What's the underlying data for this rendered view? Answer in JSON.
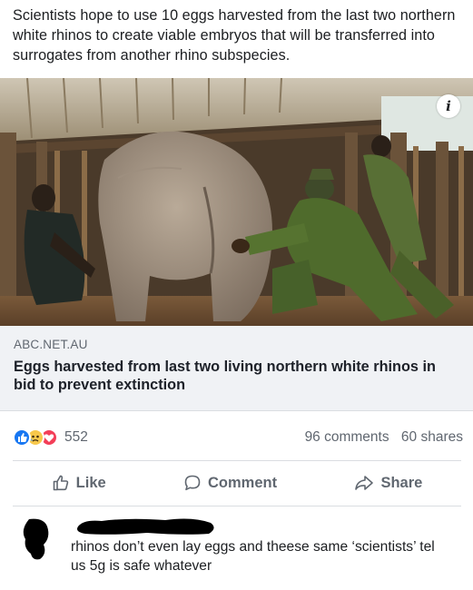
{
  "post": {
    "text": "Scientists hope to use 10 eggs harvested from the last two northern white rhinos to create viable embryos that will be transferred into surrogates from another rhino subspecies."
  },
  "photo": {
    "info_badge": "i"
  },
  "link": {
    "domain": "ABC.NET.AU",
    "title": "Eggs harvested from last two living northern white rhinos in bid to prevent extinction"
  },
  "stats": {
    "reaction_count": "552",
    "comments": "96 comments",
    "shares": "60 shares"
  },
  "actions": {
    "like": "Like",
    "comment": "Comment",
    "share": "Share"
  },
  "comment": {
    "text": "rhinos don’t even lay eggs and theese same ‘scientists’ tel us 5g is safe whatever"
  },
  "colors": {
    "facebook_blue": "#1877f2",
    "link_box_bg": "#f0f2f5",
    "secondary_text": "#606770"
  }
}
